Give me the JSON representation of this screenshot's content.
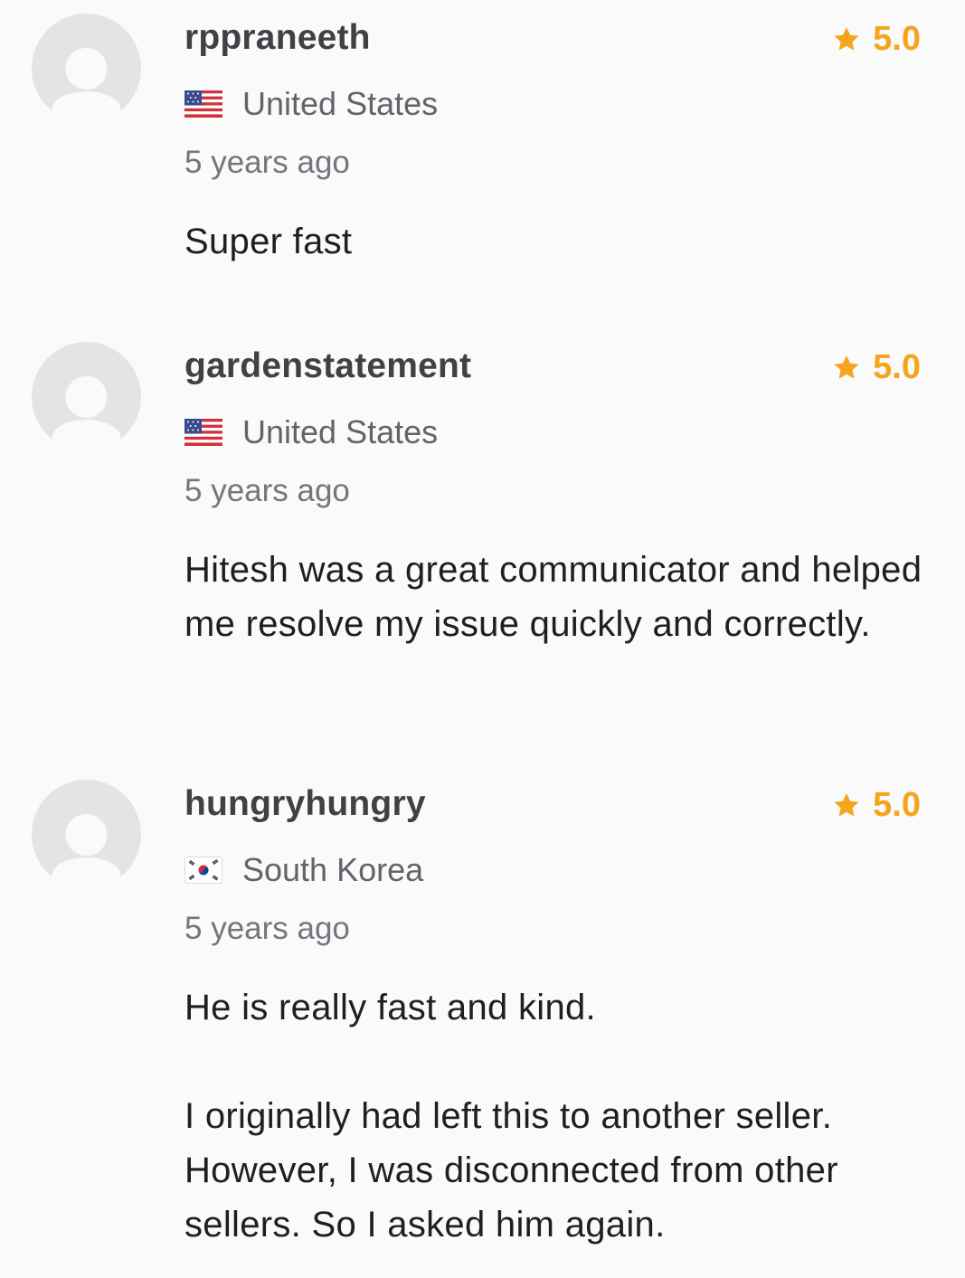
{
  "reviews": [
    {
      "username": "rppraneeth",
      "rating": "5.0",
      "country": "United States",
      "flag_icon": "us-flag-icon",
      "time_ago": "5 years ago",
      "paragraphs": [
        "Super fast"
      ]
    },
    {
      "username": "gardenstatement",
      "rating": "5.0",
      "country": "United States",
      "flag_icon": "us-flag-icon",
      "time_ago": "5 years ago",
      "paragraphs": [
        "Hitesh was a great communicator and helped me resolve my issue quickly and correctly."
      ]
    },
    {
      "username": "hungryhungry",
      "rating": "5.0",
      "country": "South Korea",
      "flag_icon": "south-korea-flag-icon",
      "time_ago": "5 years ago",
      "paragraphs": [
        "He is really fast and kind.",
        "I originally had left this to another seller. However, I was disconnected from other sellers. So I asked him again."
      ]
    }
  ],
  "colors": {
    "star": "#f4a51c",
    "avatar_bg": "#e4e4e6",
    "avatar_fg": "#fafafa",
    "page_bg": "#fafafa"
  }
}
